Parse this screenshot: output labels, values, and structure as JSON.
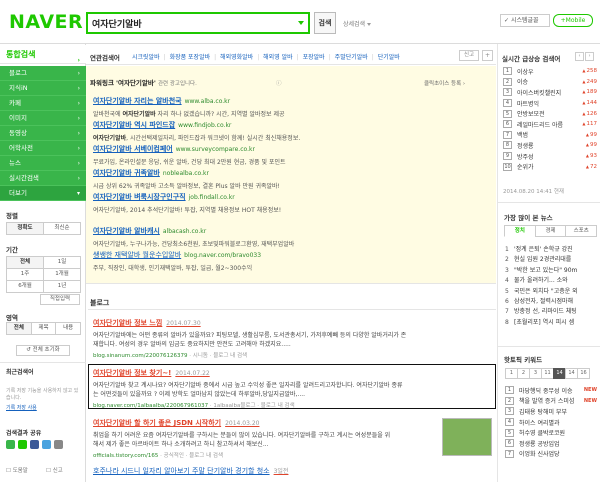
{
  "header": {
    "logo": "NAVER",
    "query": "여자단기알바",
    "search_button": "검색",
    "detail_search": "상세검색",
    "system_font": "시스템글꼴",
    "mobile": "+Mobile"
  },
  "leftnav": {
    "all_search": "통합검색",
    "items": [
      "블로그",
      "지식iN",
      "카페",
      "이미지",
      "동영상",
      "어학사전",
      "뉴스",
      "실시간검색",
      "더보기"
    ],
    "sort_title": "정렬",
    "sort_options": [
      "정확도",
      "최신순"
    ],
    "period_title": "기간",
    "period_options": [
      "전체",
      "1일",
      "1주",
      "1개월",
      "6개월",
      "1년"
    ],
    "period_custom": "직접입력",
    "area_title": "영역",
    "area_options": [
      "전체",
      "제목",
      "내용"
    ],
    "reset": "전체 초기화",
    "recent_title": "최근검색어",
    "recent_note": "기록 저장 기능을 사용하지 않고 있습니다.",
    "recent_link": "기록 저장 사용",
    "share_title": "검색결과 공유",
    "help": "도움말",
    "report": "신고"
  },
  "related": {
    "label": "연관검색어",
    "keywords": [
      "시크릿알바",
      "화장품 포장알바",
      "해외영화알바",
      "해외영 알바",
      "포장알바",
      "주말단기알바",
      "단기알바"
    ],
    "share": "신고",
    "more": "+"
  },
  "powerlink": {
    "title": "파워링크",
    "query_quote": "'여자단기알바'",
    "title_suffix": "관련 광고입니다.",
    "ad_info": "ⓘ",
    "click_choice": "클릭초이스 등록 ›",
    "ads": [
      {
        "title": "여자단기알바 자리는 알바천국",
        "url": "www.alba.co.kr",
        "desc_pre": "알바천국에 ",
        "desc_bold": "여자단기알바",
        "desc_post": " 자리 하나 없겠습니까? 시간, 지역별 알바정보 제공"
      },
      {
        "title": "여자단기알바 역시 파인드잡",
        "url": "www.findjob.co.kr",
        "desc_pre": "",
        "desc_bold": "여자단기알바",
        "desc_post": ", 시간선택제일자리, 파인드잡과 워크넷이 함께! 실시간 최신채용정보."
      },
      {
        "title": "여자단기알바 서베이컴페어",
        "url": "www.surveycompare.co.kr",
        "desc_pre": "",
        "desc_bold": "",
        "desc_post": "무료가입, 온라인설문 응답, 쉬운 알바, 건당 최대 2만원 현금, 경품 및 포인트"
      },
      {
        "title": "여자단기알바 귀족알바",
        "url": "noblealba.co.kr",
        "desc_pre": "",
        "desc_bold": "",
        "desc_post": "시급 상위 62% 귀족알바 고소득 알바정보, 결혼 Plus 알바 만원 귀족알바!"
      },
      {
        "title": "여자단기알바 벼룩시장구인구직",
        "url": "job.findall.co.kr",
        "desc_pre": "",
        "desc_bold": "",
        "desc_post": "여자단기알바, 2014 추석단기알바! 투잡, 지역별 채용정보 HOT 채용정보!"
      },
      {
        "title": "여자단기알바 알바캐시",
        "url": "albacash.co.kr",
        "desc_pre": "",
        "desc_bold": "",
        "desc_post": "여자단기알바, 누구나가능, 건당최소6천원, 초보및파워블로그환영, 재택부업알바"
      },
      {
        "title": "쌩쌩한 재택알바 월운수입알바",
        "url": "blog.naver.com/bravo033",
        "desc_pre": "",
        "desc_bold": "",
        "desc_post": "주부, 직장인, 대학생, 인기재택알바, 투잡, 일급, 월2~300수익"
      }
    ]
  },
  "blog": {
    "title": "블로그",
    "posts": [
      {
        "title": "여자단기알바 정보 느낌",
        "date": "2014.07.30",
        "desc1": "여자단기알바에는 어떤 종류의 알바가 있을까요? 피팅모델, 생활심부름, 도서관총서기, 가저후예빼 등의 다양한 알바거리가 존",
        "desc2": "재합니다. 여성의 경우 알바의 임금도 중요하지만 안전도 고려해야 하겠지요.....",
        "url": "blog.sinanum.com/220076126379",
        "tags": "시니돔 · 블로그 내 검색"
      },
      {
        "title": "여자단기알바 정보 찾기~!",
        "date": "2014.07.22",
        "desc1": "여자단기알바 찾고 계시나요? 여자단기알바 중에서 시급 높고 수익성 좋은 일자리를 알려드리고자합니다. 여자단기알바 종류",
        "desc2": "는 어떤것들이 있을까요 ? 이제 방학도 얼마남지 않았는데 하루알바,당일지급알바,....",
        "url": "blog.naver.com/1albaalba/220067961037",
        "tags": "1albaalba블로그 · 블로그 내 검색"
      },
      {
        "title": "여자단기알바 할 하기 좋은 JSDN 시작하기",
        "date": "2014.03.20",
        "desc1": "취업을 하기 어려운 요즘 여자단기알바를 구하시는 분들이 많이 있습니다. 여자단기알바를 구하고 계시는 여성분들을 위",
        "desc2": "해서 제가 좋은 아르바이트 하나 소개하려고 하니 참고하셔서 해보신...",
        "url": "officials.tistory.com/165",
        "tags": "공식적인 · 블로그 내 검색"
      },
      {
        "title": "호주나라 시드니 일자리 알아보기 주말 단기알바 경기할 청소",
        "date": "3일전",
        "desc1": "",
        "desc2": "",
        "url": "",
        "tags": ""
      }
    ]
  },
  "realtime": {
    "title": "실시간 급상승 검색어",
    "items": [
      {
        "rank": "1",
        "kw": "이상우",
        "change": "258"
      },
      {
        "rank": "2",
        "kw": "이승",
        "change": "249"
      },
      {
        "rank": "3",
        "kw": "아이스버킷챌린지",
        "change": "189"
      },
      {
        "rank": "4",
        "kw": "마트병익",
        "change": "144"
      },
      {
        "rank": "5",
        "kw": "안방보모전",
        "change": "126"
      },
      {
        "rank": "6",
        "kw": "레일마드리드 아름",
        "change": "117"
      },
      {
        "rank": "7",
        "kw": "백범",
        "change": "99"
      },
      {
        "rank": "8",
        "kw": "정생룡",
        "change": "99"
      },
      {
        "rank": "9",
        "kw": "방주성",
        "change": "93"
      },
      {
        "rank": "10",
        "kw": "순위가",
        "change": "72"
      }
    ],
    "time": "2014.08.20 14:41 현재"
  },
  "popular": {
    "title": "가장 많이 본 뉴스",
    "tabs": [
      "정치",
      "경제",
      "스포츠"
    ],
    "items": [
      "'정계 은퇴' 손학규 강진",
      "현실 입원 2경관리대를",
      "\"박한 보고 있는다\" 90m",
      "물가 올려하기... 소와",
      "국민은 외치다 \"고층운 외",
      "삼성전자, 절력시점마해",
      "방충정 선, 리마이드 체팅",
      "[초월리포] 역시 피시 셈"
    ]
  },
  "hot": {
    "title": "핫토픽 키워드",
    "tabs": [
      "1",
      "2",
      "3",
      "11",
      "14",
      "14",
      "16",
      "18"
    ],
    "items": [
      {
        "rank": "1",
        "kw": "마당행딕 중무성 이승",
        "new": "NEW"
      },
      {
        "rank": "2",
        "kw": "책을 발엮 증거 스미섬",
        "new": "NEW"
      },
      {
        "rank": "3",
        "kw": "김태용 탕해미 부부",
        "new": ""
      },
      {
        "rank": "4",
        "kw": "하이스 여리별과",
        "new": ""
      },
      {
        "rank": "5",
        "kw": "허수영 클박로코원",
        "new": ""
      },
      {
        "rank": "6",
        "kw": "정생룡 공방입업",
        "new": ""
      },
      {
        "rank": "7",
        "kw": "이엉화 신사업당",
        "new": ""
      },
      {
        "rank": "8",
        "kw": "공항 조하 힐기족",
        "new": "NEW"
      }
    ],
    "more": "더보기"
  }
}
